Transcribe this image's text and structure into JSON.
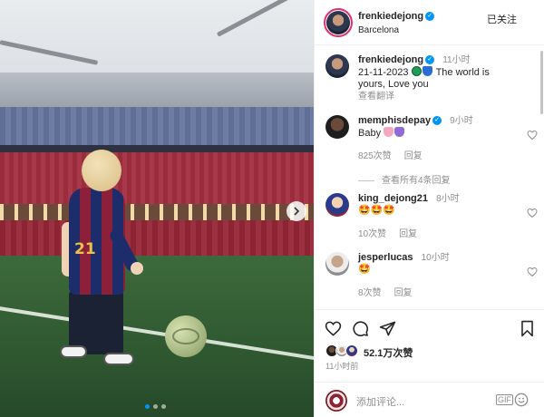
{
  "photo": {
    "jersey_number": "21",
    "carousel": {
      "count": 3,
      "active": 0
    }
  },
  "header": {
    "username": "frenkiedejong",
    "location": "Barcelona",
    "follow_label": "已关注"
  },
  "caption": {
    "username": "frenkiedejong",
    "time": "11小时",
    "text": "21-11-2023 🟢💙 The world is yours, Love you",
    "text_line1": "21-11-2023",
    "text_line1_tail": "The world is",
    "text_line2": "yours, Love you",
    "translate_label": "查看翻译"
  },
  "comments": [
    {
      "username": "memphisdepay",
      "verified": true,
      "time": "9小时",
      "text": "Baby",
      "emoji_colors": [
        "#f4a7c0",
        "#8e6bd6"
      ],
      "likes": "825次赞",
      "reply_label": "回复"
    },
    {
      "username": "king_dejong21",
      "verified": false,
      "time": "8小时",
      "text": "🤩🤩🤩",
      "likes": "10次赞",
      "reply_label": "回复"
    },
    {
      "username": "jesperlucas",
      "verified": false,
      "time": "10小时",
      "text": "🤩",
      "likes": "8次赞",
      "reply_label": "回复"
    }
  ],
  "view_replies": "查看所有4条回复",
  "likes_summary": "52.1万次赞",
  "post_time": "11小时前",
  "composer": {
    "placeholder": "添加评论...",
    "gif_label": "GIF"
  },
  "colors": {
    "accent": "#0095f6",
    "text": "#262626",
    "muted": "#8e8e8e",
    "divider": "#efefef"
  },
  "icons": [
    "heart-icon",
    "comment-icon",
    "share-icon",
    "save-icon",
    "verified-icon",
    "chevron-right-icon",
    "emoji-icon"
  ]
}
